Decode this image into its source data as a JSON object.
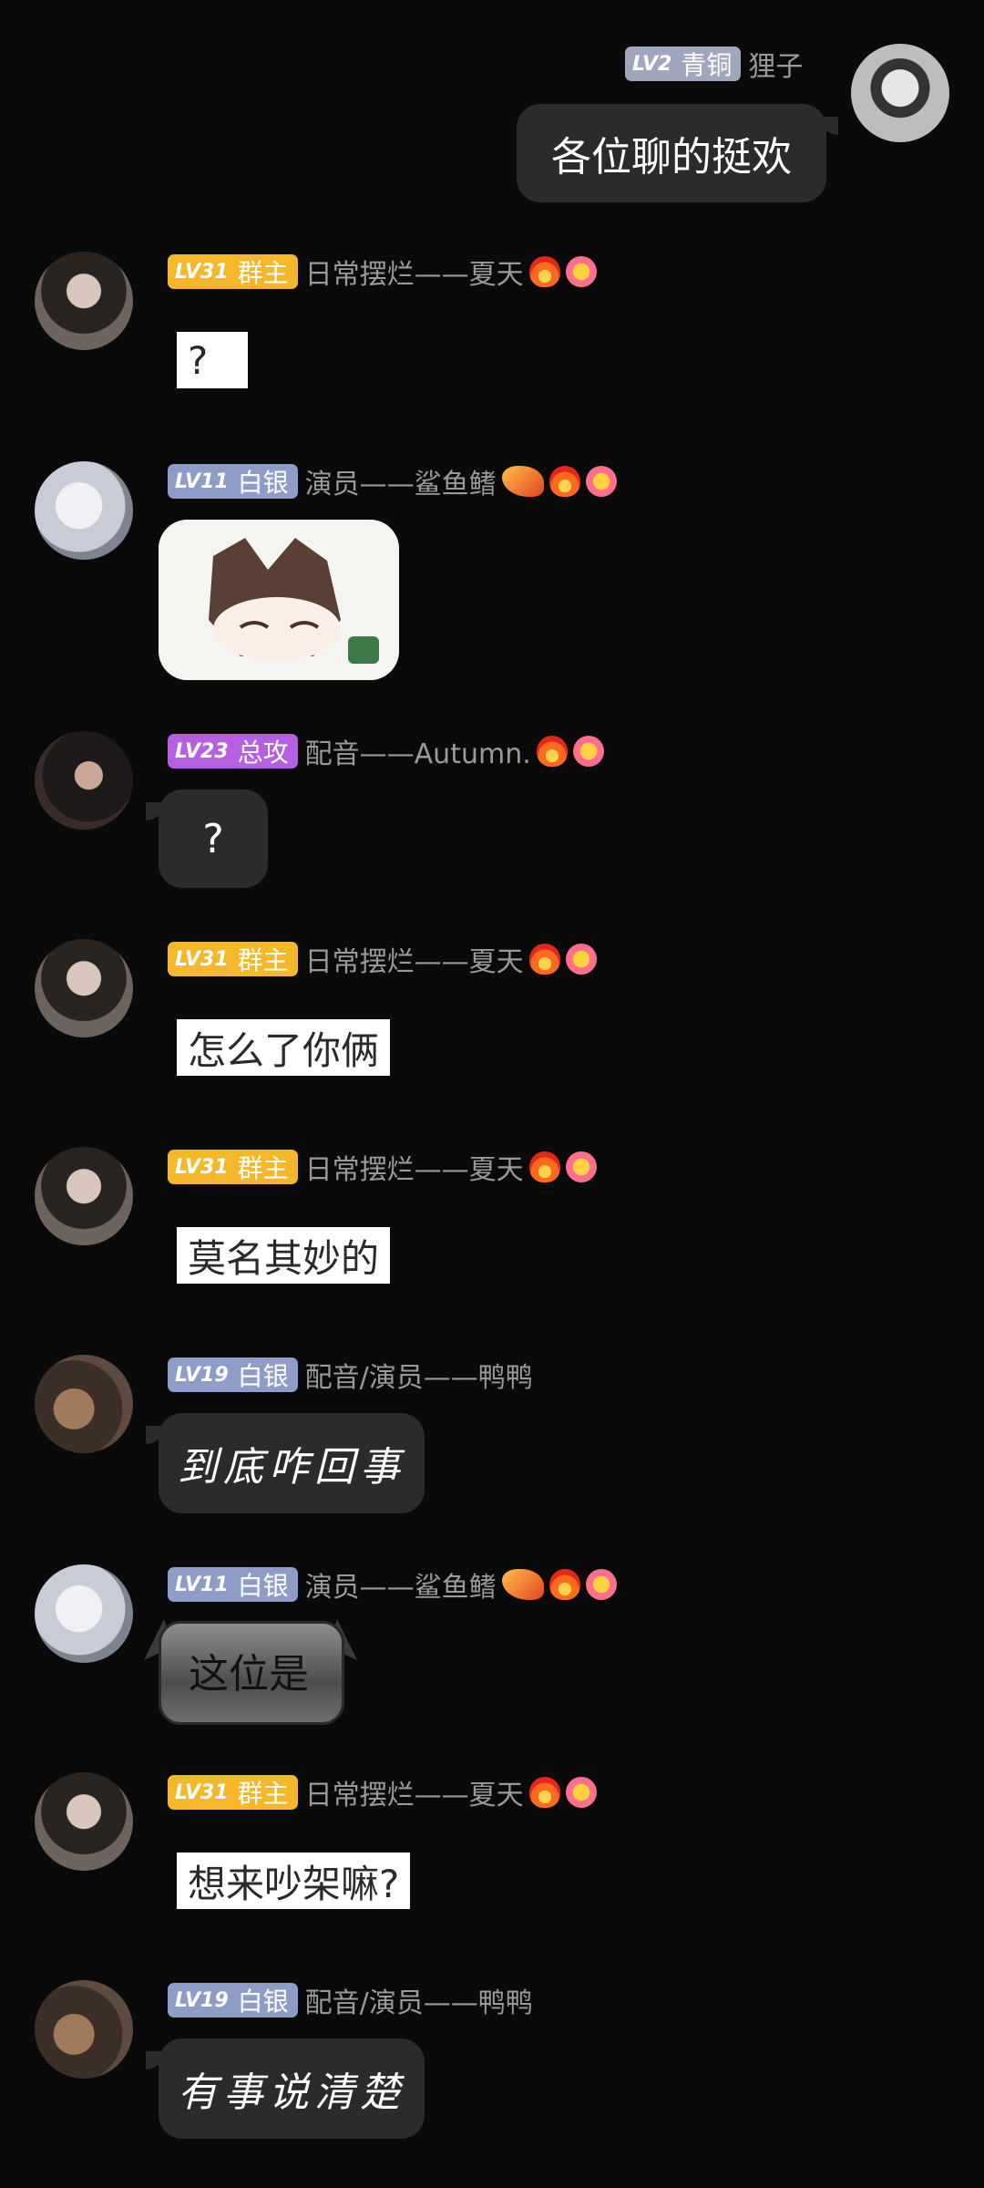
{
  "messages": [
    {
      "side": "right",
      "badge_lv": "LV2",
      "badge_title": "青铜",
      "name": "狸子",
      "text": "各位聊的挺欢",
      "avatar": "manga-avatar"
    },
    {
      "side": "left",
      "badge_lv": "LV31",
      "badge_title": "群主",
      "name": "日常摆烂——夏天",
      "text": "?",
      "avatar": "girl-avatar",
      "emojis": [
        "fire-icon",
        "flower-icon"
      ]
    },
    {
      "side": "left",
      "badge_lv": "LV11",
      "badge_title": "白银",
      "name": "演员——鲨鱼鳍",
      "text": "",
      "avatar": "white-hair-avatar",
      "emojis": [
        "dragon-icon",
        "fire-icon",
        "flower-icon"
      ],
      "sticker": "anime-sticker"
    },
    {
      "side": "left",
      "badge_lv": "LV23",
      "badge_title": "总攻",
      "name": "配音——Autumn.",
      "text": "?",
      "avatar": "dark-hair-avatar",
      "emojis": [
        "fire-icon",
        "flower-icon"
      ]
    },
    {
      "side": "left",
      "badge_lv": "LV31",
      "badge_title": "群主",
      "name": "日常摆烂——夏天",
      "text": "怎么了你俩",
      "avatar": "girl-avatar",
      "emojis": [
        "fire-icon",
        "flower-icon"
      ]
    },
    {
      "side": "left",
      "badge_lv": "LV31",
      "badge_title": "群主",
      "name": "日常摆烂——夏天",
      "text": "莫名其妙的",
      "avatar": "girl-avatar",
      "emojis": [
        "fire-icon",
        "flower-icon"
      ]
    },
    {
      "side": "left",
      "badge_lv": "LV19",
      "badge_title": "白银",
      "name": "配音/演员——鸭鸭",
      "text": "到底咋回事",
      "avatar": "brown-hair-avatar"
    },
    {
      "side": "left",
      "badge_lv": "LV11",
      "badge_title": "白银",
      "name": "演员——鲨鱼鳍",
      "text": "这位是",
      "avatar": "white-hair-avatar",
      "emojis": [
        "dragon-icon",
        "fire-icon",
        "flower-icon"
      ]
    },
    {
      "side": "left",
      "badge_lv": "LV31",
      "badge_title": "群主",
      "name": "日常摆烂——夏天",
      "text": "想来吵架嘛?",
      "avatar": "girl-avatar",
      "emojis": [
        "fire-icon",
        "flower-icon"
      ]
    },
    {
      "side": "left",
      "badge_lv": "LV19",
      "badge_title": "白银",
      "name": "配音/演员——鸭鸭",
      "text": "有事说清楚",
      "avatar": "brown-hair-avatar"
    }
  ],
  "colors": {
    "background": "#0a0a0a",
    "bubble": "#2b2b2b",
    "badge_owner": "#f5b82a",
    "badge_silver": "#8d9dc8",
    "badge_purple": "#b560e0",
    "badge_bronze": "#9fa6be"
  }
}
